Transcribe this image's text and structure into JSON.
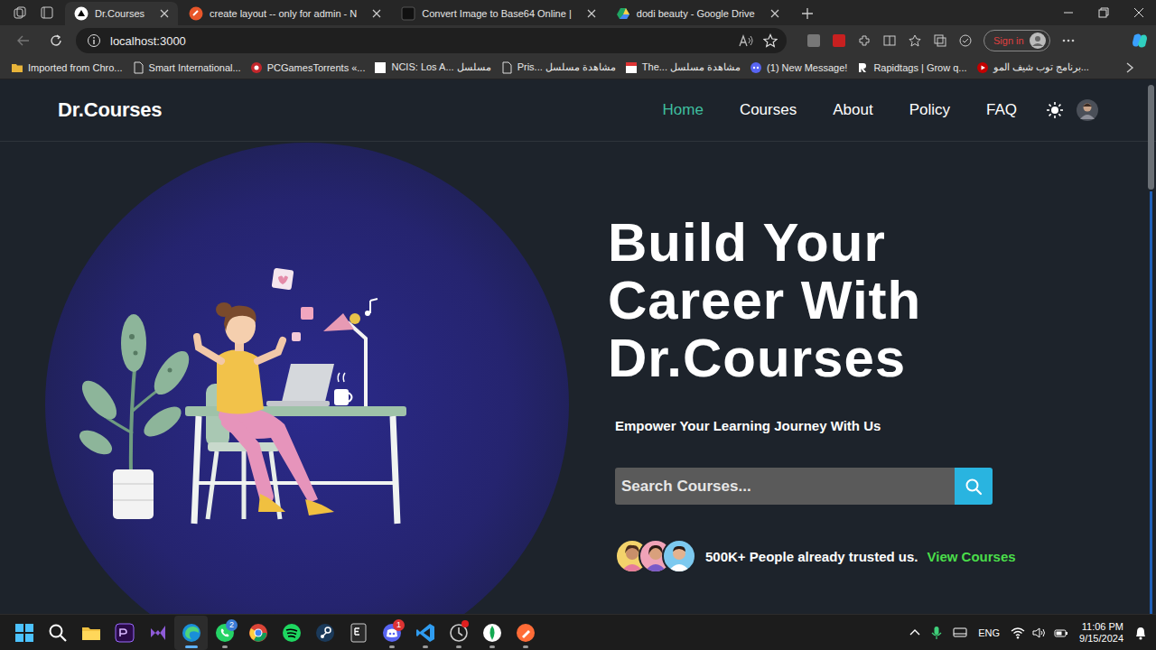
{
  "browser": {
    "tabs": [
      {
        "title": "Dr.Courses",
        "selected": true
      },
      {
        "title": "create layout -- only for admin - N",
        "selected": false
      },
      {
        "title": "Convert Image to Base64 Online |",
        "selected": false
      },
      {
        "title": "dodi beauty - Google Drive",
        "selected": false
      }
    ],
    "address": "localhost:3000",
    "sign_in": "Sign in",
    "bookmarks": [
      "Imported from Chro...",
      "Smart International...",
      "PCGamesTorrents «...",
      "NCIS: Los A... مسلسل",
      "Pris... مشاهدة مسلسل",
      "The... مشاهدة مسلسل",
      "(1) New Message!",
      "Rapidtags | Grow q...",
      "برنامج توب شيف المو..."
    ]
  },
  "page": {
    "logo": "Dr.Courses",
    "nav": [
      {
        "label": "Home",
        "selected": true
      },
      {
        "label": "Courses",
        "selected": false
      },
      {
        "label": "About",
        "selected": false
      },
      {
        "label": "Policy",
        "selected": false
      },
      {
        "label": "FAQ",
        "selected": false
      }
    ],
    "hero": {
      "title": [
        "Build Your",
        "Career With",
        "Dr.Courses"
      ],
      "subtitle": "Empower Your Learning Journey With Us",
      "search": {
        "placeholder": "Search Courses..."
      },
      "trust": {
        "text": "500K+ People already trusted us.",
        "link": "View Courses"
      }
    }
  },
  "taskbar": {
    "apps": [
      {
        "running": false,
        "active": false,
        "alert": false
      },
      {
        "running": false,
        "active": false,
        "alert": false
      },
      {
        "running": false,
        "active": false,
        "alert": false
      },
      {
        "running": false,
        "active": false,
        "alert": false
      },
      {
        "running": false,
        "active": false,
        "alert": false
      },
      {
        "running": true,
        "active": true,
        "alert": false
      },
      {
        "running": true,
        "active": false,
        "alert": false,
        "badge": "2"
      },
      {
        "running": false,
        "active": false,
        "alert": false
      },
      {
        "running": false,
        "active": false,
        "alert": false
      },
      {
        "running": false,
        "active": false,
        "alert": false
      },
      {
        "running": false,
        "active": false,
        "alert": false
      },
      {
        "running": true,
        "active": false,
        "alert": false,
        "badge": "1"
      },
      {
        "running": true,
        "active": false,
        "alert": false
      },
      {
        "running": true,
        "active": false,
        "alert": true
      },
      {
        "running": true,
        "active": false,
        "alert": false
      },
      {
        "running": true,
        "active": false,
        "alert": false
      }
    ],
    "language": "ENG",
    "time": "11:06 PM",
    "date": "9/15/2024"
  }
}
